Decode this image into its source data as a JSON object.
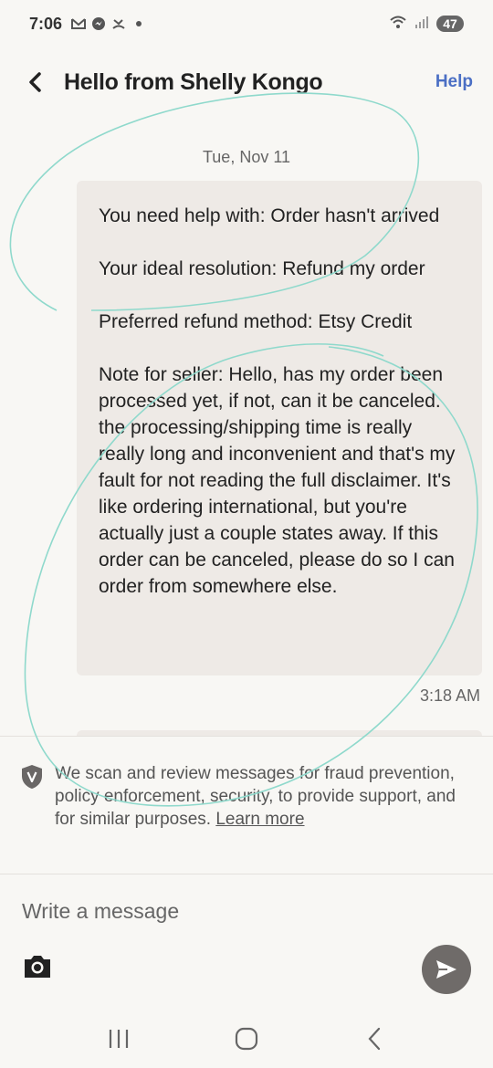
{
  "status_bar": {
    "time": "7:06",
    "battery": "47",
    "icons": [
      "gmail-icon",
      "messenger-icon",
      "missed-call-icon",
      "dot-icon",
      "wifi-icon",
      "signal-icon"
    ]
  },
  "header": {
    "title": "Hello from Shelly Kongo",
    "help_label": "Help"
  },
  "conversation": {
    "date": "Tue, Nov 11",
    "message": {
      "paragraphs": [
        "You need help with: Order hasn't arrived",
        "Your ideal resolution: Refund my order",
        "Preferred refund method: Etsy Credit",
        "Note for seller: Hello, has my order been processed yet, if not, can it be canceled. the processing/shipping time is really really long and inconvenient and that's my fault for not reading the full disclaimer. It's like ordering international, but you're actually just a couple states away. If this order can be canceled, please do so I can order from somewhere else."
      ],
      "time": "3:18 AM"
    }
  },
  "disclaimer": {
    "text": "We scan and review messages for fraud prevention, policy enforcement, security, to provide support, and for similar purposes.",
    "learn_more": "Learn more"
  },
  "composer": {
    "placeholder": "Write a message",
    "value": ""
  },
  "colors": {
    "background": "#f8f7f4",
    "bubble": "#eeeae6",
    "help_link": "#4b6fc4",
    "send_button": "#6f6b69",
    "scribble": "#8fd9cc"
  }
}
